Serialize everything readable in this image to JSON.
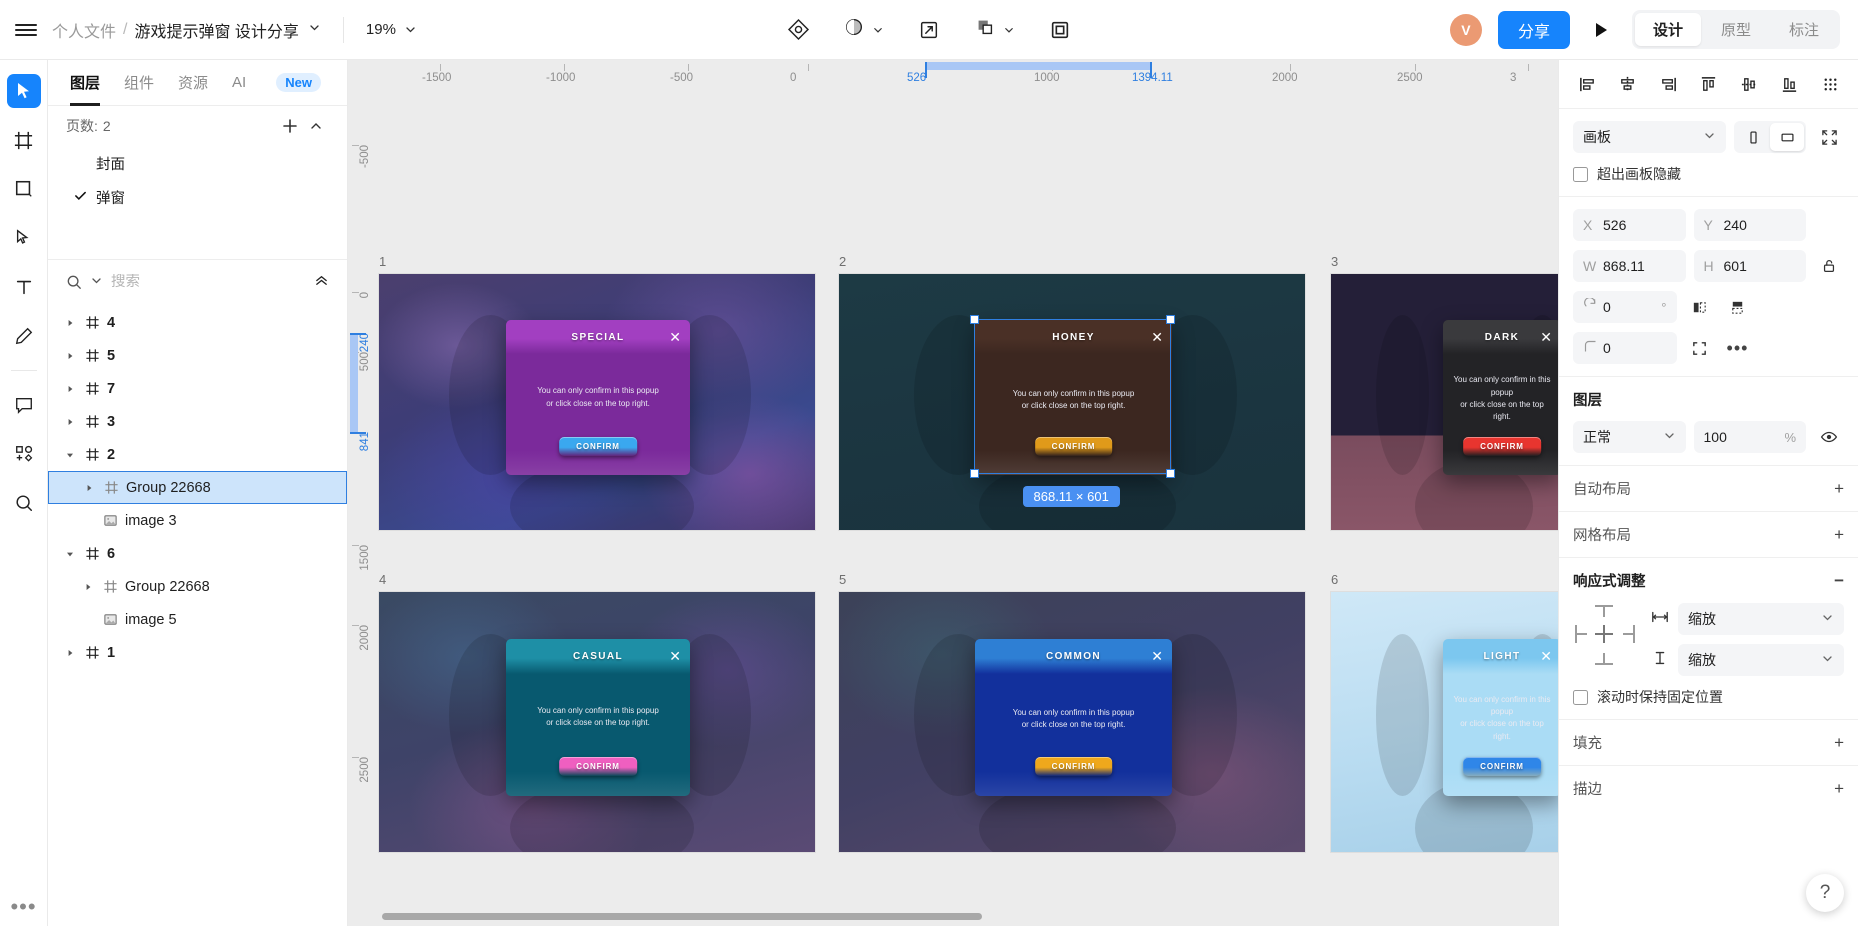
{
  "topbar": {
    "menu_icon": "hamburger-icon",
    "breadcrumb_folder": "个人文件",
    "breadcrumb_sep": "/",
    "breadcrumb_file": "游戏提示弹窗 设计分享",
    "zoom_level": "19%",
    "center_icons": [
      "target-icon",
      "contrast-icon",
      "export-icon",
      "boolean-icon",
      "frame-icon"
    ],
    "avatar_initial": "V",
    "share_label": "分享",
    "play_icon": "play-icon",
    "mode_tabs": [
      {
        "label": "设计",
        "active": true
      },
      {
        "label": "原型",
        "active": false
      },
      {
        "label": "标注",
        "active": false
      }
    ]
  },
  "tool_rail": [
    {
      "name": "cursor-tool",
      "active": true
    },
    {
      "name": "frame-tool",
      "active": false
    },
    {
      "name": "rectangle-tool",
      "active": false
    },
    {
      "name": "pen-tool",
      "active": false
    },
    {
      "name": "text-tool",
      "active": false
    },
    {
      "name": "pencil-tool",
      "active": false
    },
    {
      "name": "comment-tool",
      "active": false
    },
    {
      "name": "component-tool",
      "active": false
    },
    {
      "name": "zoom-tool",
      "active": false
    }
  ],
  "left_panel": {
    "tabs": [
      {
        "label": "图层",
        "active": true
      },
      {
        "label": "组件",
        "active": false
      },
      {
        "label": "资源",
        "active": false
      },
      {
        "label": "AI",
        "active": false
      }
    ],
    "new_badge": "New",
    "pages_label": "页数:",
    "pages_count": "2",
    "add_page_icon": "plus-icon",
    "collapse_pages_icon": "chevron-up-icon",
    "pages": [
      {
        "name": "封面",
        "checked": false
      },
      {
        "name": "弹窗",
        "checked": true
      }
    ],
    "search_placeholder": "搜索",
    "search_value": "",
    "search_icon": "search-icon",
    "filter_icon": "chevron-down-icon",
    "collapse_all_icon": "collapse-all-icon",
    "layers": [
      {
        "name": "4",
        "type": "frame",
        "depth": 0,
        "expanded": false,
        "bold": true,
        "selected": false
      },
      {
        "name": "5",
        "type": "frame",
        "depth": 0,
        "expanded": false,
        "bold": true,
        "selected": false
      },
      {
        "name": "7",
        "type": "frame",
        "depth": 0,
        "expanded": false,
        "bold": true,
        "selected": false
      },
      {
        "name": "3",
        "type": "frame",
        "depth": 0,
        "expanded": false,
        "bold": true,
        "selected": false
      },
      {
        "name": "2",
        "type": "frame",
        "depth": 0,
        "expanded": true,
        "bold": true,
        "selected": false
      },
      {
        "name": "Group 22668",
        "type": "frame",
        "depth": 1,
        "expanded": false,
        "bold": false,
        "selected": true
      },
      {
        "name": "image 3",
        "type": "image",
        "depth": 1,
        "expanded": null,
        "bold": false,
        "selected": false
      },
      {
        "name": "6",
        "type": "frame",
        "depth": 0,
        "expanded": true,
        "bold": true,
        "selected": false
      },
      {
        "name": "Group 22668",
        "type": "frame",
        "depth": 1,
        "expanded": false,
        "bold": false,
        "selected": false
      },
      {
        "name": "image 5",
        "type": "image",
        "depth": 1,
        "expanded": null,
        "bold": false,
        "selected": false
      },
      {
        "name": "1",
        "type": "frame",
        "depth": 0,
        "expanded": false,
        "bold": true,
        "selected": false
      }
    ]
  },
  "canvas": {
    "ruler_h_ticks": [
      "-1500",
      "-1000",
      "-500",
      "0",
      "526",
      "1000",
      "1394.11",
      "2000",
      "2500",
      "3"
    ],
    "ruler_h_highlight": [
      "526",
      "1394.11"
    ],
    "ruler_v_ticks": [
      "-500",
      "0",
      "240",
      "500",
      "841",
      "1500",
      "2000",
      "2500"
    ],
    "ruler_v_highlight": [
      "240",
      "841"
    ],
    "selection_size_badge": "868.11 × 601",
    "artboards": [
      {
        "label": "1",
        "theme": "bg-a",
        "popup": {
          "title": "SPECIAL",
          "message": "You can only confirm in this popup\nor click close on the top right.",
          "button": "CONFIRM",
          "head_color": "#a23fc1",
          "body_color": "#7b2a9b",
          "btn_color": "#3aa8ef",
          "close": "✕"
        }
      },
      {
        "label": "2",
        "theme": "bg-b",
        "popup": {
          "title": "HONEY",
          "message": "You can only confirm in this popup\nor click close on the top right.",
          "button": "CONFIRM",
          "head_color": "#4a3026",
          "body_color": "#3c2720",
          "btn_color": "#e09a1a",
          "close": "✕"
        }
      },
      {
        "label": "3",
        "theme": "bg-c",
        "popup": {
          "title": "DARK",
          "message": "You can only confirm in this popup\nor click close on the top right.",
          "button": "CONFIRM",
          "head_color": "#3a3a3d",
          "body_color": "#232326",
          "btn_color": "#e8352f",
          "close": "✕"
        }
      },
      {
        "label": "4",
        "theme": "bg-d",
        "popup": {
          "title": "CASUAL",
          "message": "You can only confirm in this popup\nor click close on the top right.",
          "button": "CONFIRM",
          "head_color": "#1e8fa6",
          "body_color": "#08596f",
          "btn_color": "#ef5fc0",
          "close": "✕"
        }
      },
      {
        "label": "5",
        "theme": "bg-e",
        "popup": {
          "title": "COMMON",
          "message": "You can only confirm in this popup\nor click close on the top right.",
          "button": "CONFIRM",
          "head_color": "#2e7fd4",
          "body_color": "#12309c",
          "btn_color": "#efa81c",
          "close": "✕"
        }
      },
      {
        "label": "6",
        "theme": "bg-f",
        "popup": {
          "title": "LIGHT",
          "message": "You can only confirm in this popup\nor click close on the top right.",
          "button": "CONFIRM",
          "head_color": "#7cc7ef",
          "body_color": "#aadcf5",
          "btn_color": "#2f86e8",
          "close": "✕"
        }
      }
    ]
  },
  "right_panel": {
    "align_icons": [
      "align-left-icon",
      "align-center-h-icon",
      "align-right-icon",
      "align-top-icon",
      "align-center-v-icon",
      "align-bottom-icon",
      "distribute-icon"
    ],
    "type_select": "画板",
    "orientation_portrait_icon": "portrait-icon",
    "orientation_landscape_icon": "landscape-icon",
    "orientation_active": "landscape",
    "fit_icon": "fit-content-icon",
    "clip_checkbox_label": "超出画板隐藏",
    "clip_checked": false,
    "x_label": "X",
    "x_value": "526",
    "y_label": "Y",
    "y_value": "240",
    "w_label": "W",
    "w_value": "868.11",
    "h_label": "H",
    "h_value": "601",
    "lock_icon": "unlock-icon",
    "rotation_label": "rotation-icon",
    "rotation_value": "0",
    "rotation_unit": "°",
    "flip_h_icon": "flip-horizontal-icon",
    "flip_v_icon": "flip-vertical-icon",
    "radius_label": "corner-radius-icon",
    "radius_value": "0",
    "independent_corners_icon": "independent-corners-icon",
    "more_icon": "more-options-icon",
    "layer_section_title": "图层",
    "blend_mode": "正常",
    "opacity_value": "100",
    "opacity_unit": "%",
    "visibility_icon": "eye-icon",
    "autolayout_title": "自动布局",
    "autolayout_add": "+",
    "gridlayout_title": "网格布局",
    "gridlayout_add": "+",
    "responsive_title": "响应式调整",
    "responsive_collapse": "−",
    "responsive_h_icon": "horizontal-resize-icon",
    "responsive_h_value": "缩放",
    "responsive_v_icon": "vertical-resize-icon",
    "responsive_v_value": "缩放",
    "fixed_on_scroll_label": "滚动时保持固定位置",
    "fixed_on_scroll_checked": false,
    "fill_title": "填充",
    "fill_add": "+",
    "stroke_title": "描边",
    "stroke_add": "+",
    "help_icon": "?"
  }
}
